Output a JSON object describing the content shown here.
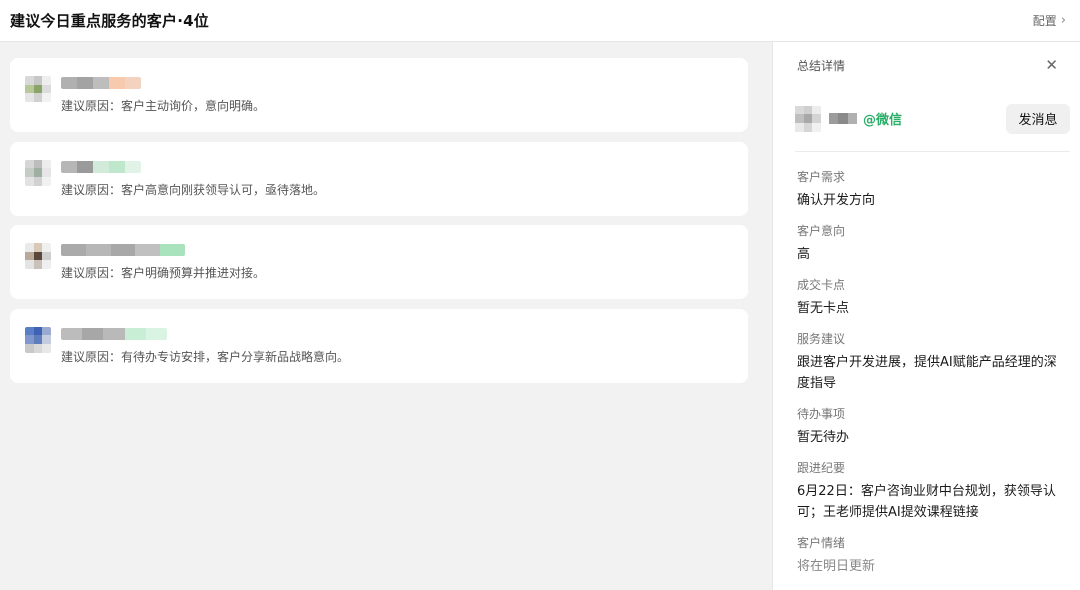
{
  "header": {
    "title": "建议今日重点服务的客户·4位",
    "config_label": "配置"
  },
  "customers": [
    {
      "reason_label": "建议原因：",
      "reason_text": "客户主动询价，意向明确。",
      "avatar_colors": [
        "#d9d9d9",
        "#c7c7c7",
        "#eeeeee",
        "#b9c79b",
        "#8aa56a",
        "#dcdcdc",
        "#e5e5e5",
        "#d0d0d0",
        "#f2f2f2"
      ],
      "name_colors": [
        "#b0b0b0",
        "#a3a3a3",
        "#bdbdbd",
        "#f7c9ad",
        "#f3d3bf"
      ]
    },
    {
      "reason_label": "建议原因：",
      "reason_text": "客户高意向刚获领导认可，亟待落地。",
      "avatar_colors": [
        "#d6d6d6",
        "#bdbdbd",
        "#ededed",
        "#c5ccc5",
        "#9fb0a2",
        "#e6e6e6",
        "#e2e2e2",
        "#d1d1d1",
        "#f1f1f1"
      ],
      "name_colors": [
        "#b6b6b6",
        "#9a9a9a",
        "#d2ead9",
        "#bfe7cb",
        "#e0f3e6"
      ]
    },
    {
      "reason_label": "建议原因：",
      "reason_text": "客户明确预算并推进对接。",
      "avatar_colors": [
        "#eaeaea",
        "#d8c9b9",
        "#f0f0f0",
        "#b8aa9a",
        "#5b463a",
        "#cfcfcf",
        "#e4e4e4",
        "#c9c2bb",
        "#efefef"
      ],
      "name_colors": [
        "#aaaaaa",
        "#b7b7b7",
        "#a8a8a8",
        "#c0c0c0",
        "#a9e3bd"
      ]
    },
    {
      "reason_label": "建议原因：",
      "reason_text": "有待办专访安排，客户分享新品战略意向。",
      "avatar_colors": [
        "#5b7fc6",
        "#3f63b4",
        "#9aa9cf",
        "#7f97cc",
        "#5f7cbd",
        "#c4cde0",
        "#c9c9c9",
        "#d8d8d8",
        "#e8e8e8"
      ],
      "name_colors": [
        "#bcbcbc",
        "#a7a7a7",
        "#b9b9b9",
        "#c8eed6",
        "#d9f4e2"
      ]
    }
  ],
  "panel": {
    "title": "总结详情",
    "wechat_tag": "@微信",
    "send_label": "发消息",
    "avatar_colors": [
      "#d9d9d9",
      "#cfcfcf",
      "#ececec",
      "#bfbfbf",
      "#a8a8a8",
      "#d4d4d4",
      "#e9e9e9",
      "#d6d6d6",
      "#f0f0f0"
    ],
    "name_colors": [
      "#9c9c9c",
      "#8a8a8a",
      "#b0b0b0"
    ],
    "fields": [
      {
        "label": "客户需求",
        "value": "确认开发方向"
      },
      {
        "label": "客户意向",
        "value": "高"
      },
      {
        "label": "成交卡点",
        "value": "暂无卡点"
      },
      {
        "label": "服务建议",
        "value": "跟进客户开发进展，提供AI赋能产品经理的深度指导"
      },
      {
        "label": "待办事项",
        "value": "暂无待办"
      },
      {
        "label": "跟进纪要",
        "value": "6月22日：客户咨询业财中台规划，获领导认可；王老师提供AI提效课程链接"
      },
      {
        "label": "客户情绪",
        "value": "将在明日更新",
        "muted": true
      }
    ]
  }
}
